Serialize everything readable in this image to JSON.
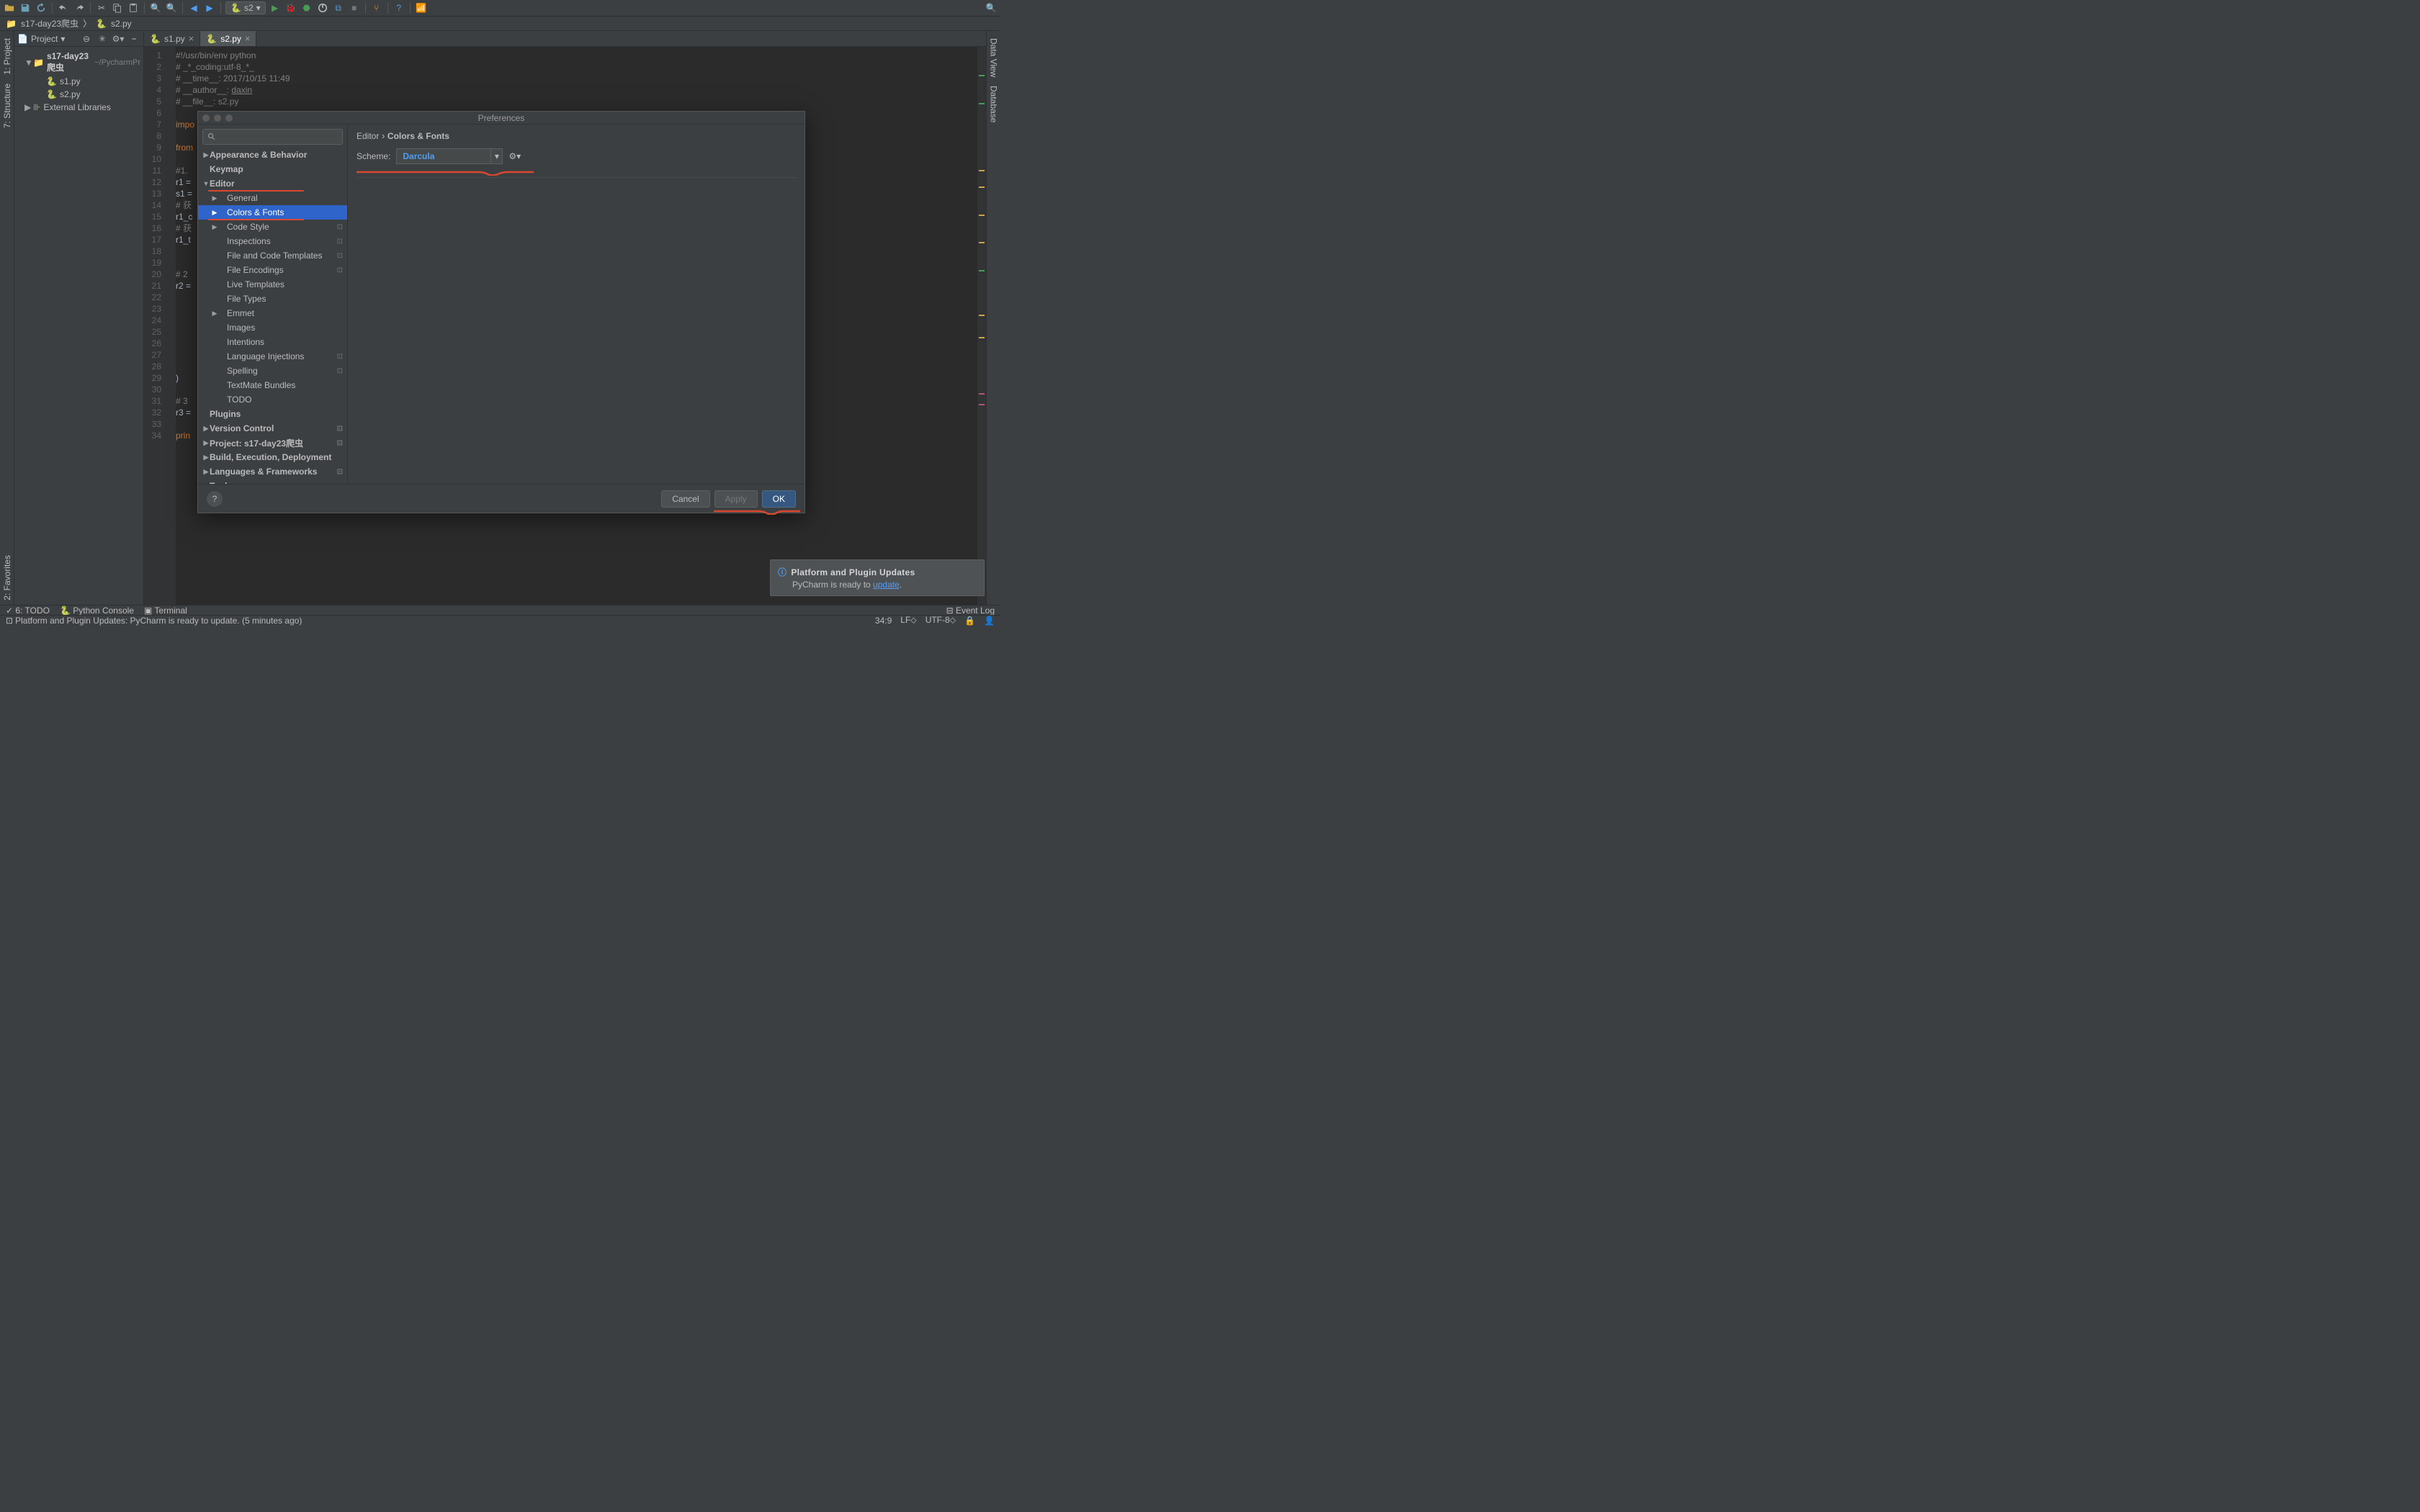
{
  "toolbar": {
    "run_config_label": "s2"
  },
  "breadcrumbs": {
    "project": "s17-day23爬虫",
    "file": "s2.py"
  },
  "project_panel": {
    "title": "Project",
    "root_name": "s17-day23爬虫",
    "root_path": "~/PycharmPr",
    "files": [
      "s1.py",
      "s2.py"
    ],
    "ext_lib": "External Libraries"
  },
  "tabs": [
    {
      "label": "s1.py",
      "active": false
    },
    {
      "label": "s2.py",
      "active": true
    }
  ],
  "editor": {
    "lines": 34,
    "code": [
      "#!/usr/bin/env python",
      "# _*_coding:utf-8_*_",
      "# __time__: 2017/10/15 11:49",
      "# __author__: daxin",
      "# __file__: s2.py",
      "",
      "impo",
      "",
      "from",
      "",
      "#1.",
      "r1 =",
      "s1 =",
      "# 获",
      "r1_c",
      "# 获",
      "r1_t",
      "",
      "",
      "# 2",
      "r2 =",
      "",
      "",
      "",
      "",
      "",
      "",
      "",
      ")",
      "",
      "# 3",
      "r3 =",
      "",
      "prin"
    ]
  },
  "dialog": {
    "title": "Preferences",
    "breadcrumb": [
      "Editor",
      "Colors & Fonts"
    ],
    "scheme_label": "Scheme:",
    "scheme_value": "Darcula",
    "search_placeholder": "",
    "tree": [
      {
        "label": "Appearance & Behavior",
        "level": 0,
        "arrow": "▶",
        "bold": true
      },
      {
        "label": "Keymap",
        "level": 0,
        "bold": true
      },
      {
        "label": "Editor",
        "level": 0,
        "arrow": "▼",
        "bold": true,
        "underline": true
      },
      {
        "label": "General",
        "level": 1,
        "arrow": "▶"
      },
      {
        "label": "Colors & Fonts",
        "level": 1,
        "arrow": "▶",
        "selected": true,
        "underline": true
      },
      {
        "label": "Code Style",
        "level": 1,
        "arrow": "▶",
        "badge": "⊡"
      },
      {
        "label": "Inspections",
        "level": 1,
        "badge": "⊡"
      },
      {
        "label": "File and Code Templates",
        "level": 1,
        "badge": "⊡"
      },
      {
        "label": "File Encodings",
        "level": 1,
        "badge": "⊡"
      },
      {
        "label": "Live Templates",
        "level": 1
      },
      {
        "label": "File Types",
        "level": 1
      },
      {
        "label": "Emmet",
        "level": 1,
        "arrow": "▶"
      },
      {
        "label": "Images",
        "level": 1
      },
      {
        "label": "Intentions",
        "level": 1
      },
      {
        "label": "Language Injections",
        "level": 1,
        "badge": "⊡"
      },
      {
        "label": "Spelling",
        "level": 1,
        "badge": "⊡"
      },
      {
        "label": "TextMate Bundles",
        "level": 1
      },
      {
        "label": "TODO",
        "level": 1
      },
      {
        "label": "Plugins",
        "level": 0,
        "bold": true
      },
      {
        "label": "Version Control",
        "level": 0,
        "arrow": "▶",
        "bold": true,
        "badge": "⊡"
      },
      {
        "label": "Project: s17-day23爬虫",
        "level": 0,
        "arrow": "▶",
        "bold": true,
        "badge": "⊡"
      },
      {
        "label": "Build, Execution, Deployment",
        "level": 0,
        "arrow": "▶",
        "bold": true
      },
      {
        "label": "Languages & Frameworks",
        "level": 0,
        "arrow": "▶",
        "bold": true,
        "badge": "⊡"
      },
      {
        "label": "Tools",
        "level": 0,
        "arrow": "▶",
        "bold": true
      }
    ],
    "buttons": {
      "cancel": "Cancel",
      "apply": "Apply",
      "ok": "OK"
    }
  },
  "notification": {
    "title": "Platform and Plugin Updates",
    "body_prefix": "PyCharm is ready to ",
    "body_link": "update",
    "body_suffix": "."
  },
  "tool_windows": {
    "todo": "6: TODO",
    "pyconsole": "Python Console",
    "terminal": "Terminal",
    "eventlog": "Event Log"
  },
  "status": {
    "msg": "Platform and Plugin Updates: PyCharm is ready to update. (5 minutes ago)",
    "pos": "34:9",
    "lf": "LF⬦",
    "enc": "UTF-8⬦"
  },
  "side_tabs": {
    "project": "1: Project",
    "structure": "7: Structure",
    "favorites": "2: Favorites",
    "dataview": "Data View",
    "database": "Database"
  }
}
